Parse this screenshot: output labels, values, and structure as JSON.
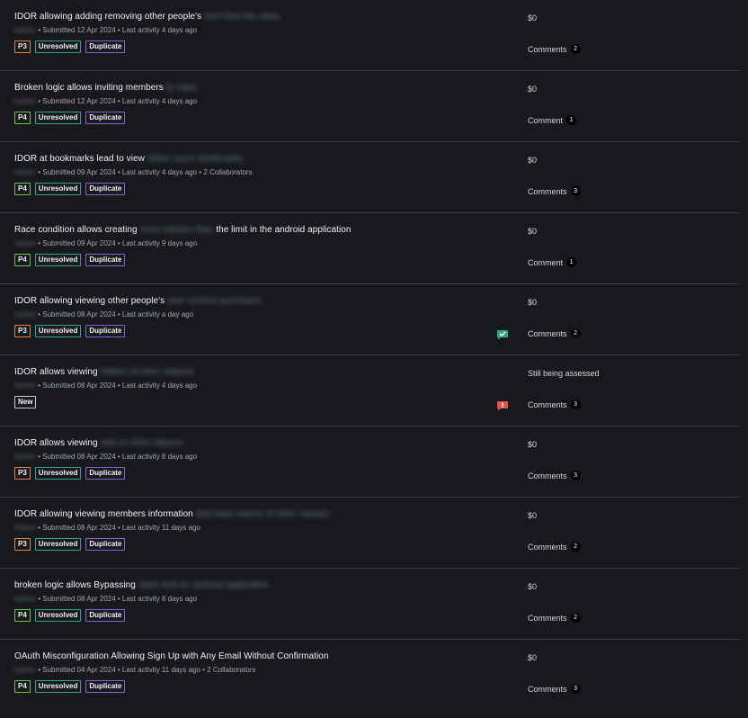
{
  "reports": [
    {
      "title": "IDOR allowing adding removing other people's",
      "title_suffix": "sets from the class",
      "user": "hacker",
      "meta": "• Submitted 12 Apr 2024 • Last activity 4 days ago",
      "priority": "P3",
      "state": "Unresolved",
      "substate": "Duplicate",
      "reward": "$0",
      "comments_label": "Comments",
      "comments_count": "2"
    },
    {
      "title": "Broken logic allows inviting members",
      "title_suffix": "to class",
      "user": "hacker",
      "meta": "• Submitted 12 Apr 2024 • Last activity 4 days ago",
      "priority": "P4",
      "state": "Unresolved",
      "substate": "Duplicate",
      "reward": "$0",
      "comments_label": "Comment",
      "comments_count": "1"
    },
    {
      "title": "IDOR at bookmarks lead to view",
      "title_suffix": "Other users' bookmarks",
      "user": "hacker",
      "meta": "• Submitted 09 Apr 2024 • Last activity 4 days ago • 2 Collaborators",
      "priority": "P4",
      "state": "Unresolved",
      "substate": "Duplicate",
      "reward": "$0",
      "comments_label": "Comments",
      "comments_count": "3"
    },
    {
      "title": "Race condition allows creating",
      "title_suffix": "more classes than",
      "title_end": " the limit in the android application",
      "user": "hacker",
      "meta": "• Submitted 09 Apr 2024 • Last activity 9 days ago",
      "priority": "P4",
      "state": "Unresolved",
      "substate": "Duplicate",
      "reward": "$0",
      "comments_label": "Comment",
      "comments_count": "1"
    },
    {
      "title": "IDOR allowing viewing other people's",
      "title_suffix": "user content purchases",
      "user": "hacker",
      "meta": "• Submitted 08 Apr 2024 • Last activity a day ago",
      "priority": "P3",
      "state": "Unresolved",
      "substate": "Duplicate",
      "reward": "$0",
      "comments_label": "Comments",
      "comments_count": "2",
      "status_icon": "check-chat-icon",
      "status_color": "#2fa589"
    },
    {
      "title": "IDOR allows viewing",
      "title_suffix": "folders of other classes",
      "user": "hacker",
      "meta": "• Submitted 08 Apr 2024 • Last activity 4 days ago",
      "state": "New",
      "reward": "Still being assessed",
      "comments_label": "Comments",
      "comments_count": "3",
      "status_icon": "alert-chat-icon",
      "status_color": "#e0524c"
    },
    {
      "title": "IDOR allows viewing",
      "title_suffix": "sets in other classes",
      "user": "hacker",
      "meta": "• Submitted 08 Apr 2024 • Last activity 8 days ago",
      "priority": "P3",
      "state": "Unresolved",
      "substate": "Duplicate",
      "reward": "$0",
      "comments_label": "Comments",
      "comments_count": "3"
    },
    {
      "title": "IDOR allowing viewing members information",
      "title_suffix": "and class tokens of other classes",
      "user": "hacker",
      "meta": "• Submitted 08 Apr 2024 • Last activity 11 days ago",
      "priority": "P3",
      "state": "Unresolved",
      "substate": "Duplicate",
      "reward": "$0",
      "comments_label": "Comments",
      "comments_count": "2"
    },
    {
      "title": "broken logic allows Bypassing",
      "title_suffix": "class limit on android application",
      "user": "hacker",
      "meta": "• Submitted 08 Apr 2024 • Last activity 8 days ago",
      "priority": "P4",
      "state": "Unresolved",
      "substate": "Duplicate",
      "reward": "$0",
      "comments_label": "Comments",
      "comments_count": "2"
    },
    {
      "title": "OAuth Misconfiguration Allowing Sign Up with Any Email Without Confirmation",
      "user": "hacker",
      "meta": "• Submitted 04 Apr 2024 • Last activity 11 days ago • 2 Collaborators",
      "priority": "P4",
      "state": "Unresolved",
      "substate": "Duplicate",
      "reward": "$0",
      "comments_label": "Comments",
      "comments_count": "3"
    }
  ]
}
